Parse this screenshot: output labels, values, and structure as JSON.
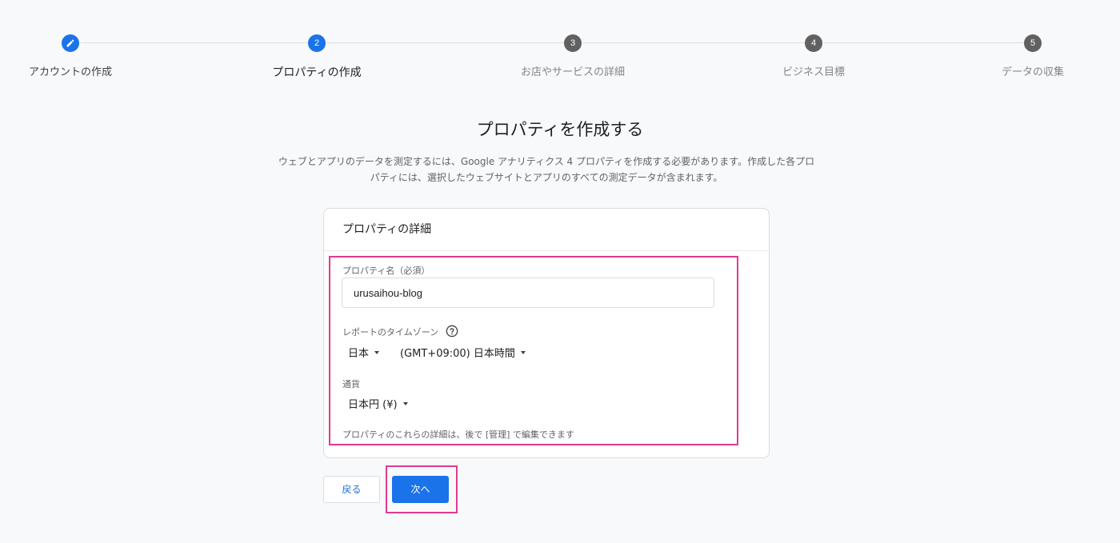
{
  "stepper": {
    "steps": [
      {
        "number": "",
        "label": "アカウントの作成",
        "state": "done",
        "icon": "pencil-icon"
      },
      {
        "number": "2",
        "label": "プロパティの作成",
        "state": "current"
      },
      {
        "number": "3",
        "label": "お店やサービスの詳細",
        "state": "upcoming"
      },
      {
        "number": "4",
        "label": "ビジネス目標",
        "state": "upcoming"
      },
      {
        "number": "5",
        "label": "データの収集",
        "state": "upcoming"
      }
    ]
  },
  "page": {
    "title": "プロパティを作成する",
    "intro_line1": "ウェブとアプリのデータを測定するには、Google アナリティクス 4 プロパティを作成する必要があります。作成した各プロ",
    "intro_line2": "パティには、選択したウェブサイトとアプリのすべての測定データが含まれます。"
  },
  "card": {
    "header": "プロパティの詳細",
    "property_name_label": "プロパティ名（必須）",
    "property_name_value": "urusaihou-blog",
    "timezone_label": "レポートのタイムゾーン",
    "help_icon": "help-circle-icon",
    "country_value": "日本",
    "timezone_value": "(GMT+09:00) 日本時間",
    "currency_label": "通貨",
    "currency_value": "日本円 (¥)",
    "hint": "プロパティのこれらの詳細は、後で [管理] で編集できます"
  },
  "actions": {
    "back_label": "戻る",
    "next_label": "次へ"
  },
  "colors": {
    "accent": "#1a73e8",
    "highlight": "#e2398f",
    "inactive_step": "#616161"
  }
}
